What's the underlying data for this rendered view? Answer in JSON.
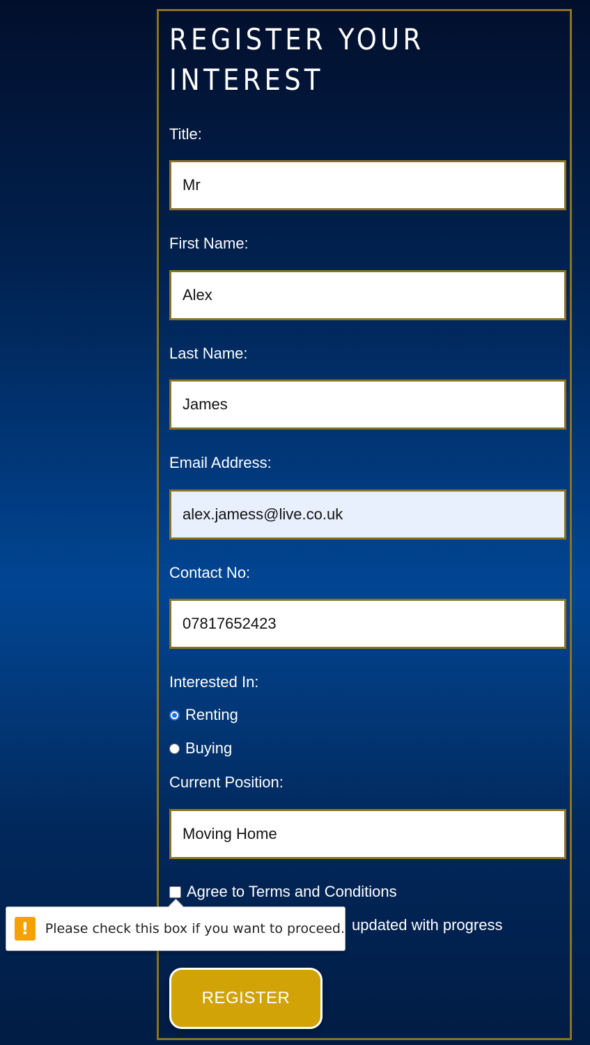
{
  "form": {
    "heading_line1": "REGISTER YOUR",
    "heading_line2": "INTEREST",
    "title": {
      "label": "Title:",
      "value": "Mr"
    },
    "first_name": {
      "label": "First Name:",
      "value": "Alex"
    },
    "last_name": {
      "label": "Last Name:",
      "value": "James"
    },
    "email": {
      "label": "Email Address:",
      "value": "alex.jamess@live.co.uk"
    },
    "contact": {
      "label": "Contact No:",
      "value": "07817652423"
    },
    "interested_in": {
      "label": "Interested In:",
      "options": [
        {
          "label": "Renting",
          "checked": true
        },
        {
          "label": "Buying",
          "checked": false
        }
      ]
    },
    "position": {
      "label": "Current Position:",
      "value": "Moving Home"
    },
    "terms_label": "Agree to Terms and Conditions",
    "updates_label_visible": "updated with progress",
    "register_label": "REGISTER"
  },
  "validation_tooltip": {
    "icon": "warning-icon",
    "icon_glyph": "!",
    "message": "Please check this box if you want to proceed."
  },
  "colors": {
    "border_gold": "#8a7421",
    "button_gold": "#d1a307",
    "radio_accent": "#1a73e8",
    "warning": "#f6a100"
  }
}
